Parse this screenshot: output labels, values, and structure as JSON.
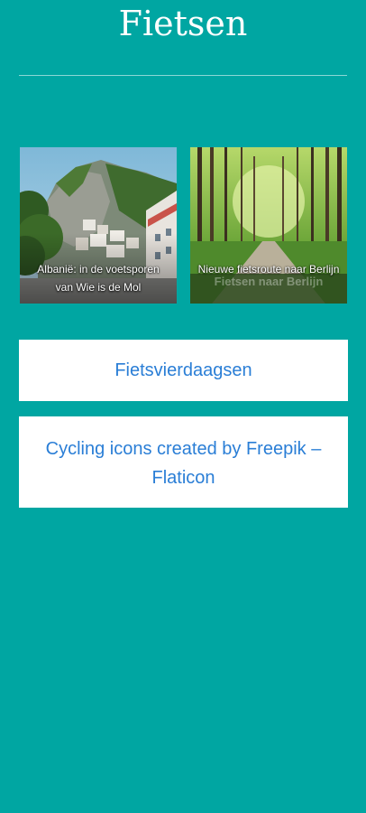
{
  "header": {
    "title": "Fietsen"
  },
  "cards": [
    {
      "caption": "Albanië: in de voetsporen van Wie is de Mol",
      "image": "albania-mountain-town-photo"
    },
    {
      "caption": "Nieuwe fietsroute naar Berlijn",
      "image": "forest-cycling-path-photo",
      "banner_text": "Fietsen naar Berlijn"
    }
  ],
  "links": [
    {
      "label": "Fietsvierdaagsen"
    },
    {
      "label": "Cycling icons created by Freepik – Flaticon"
    }
  ],
  "colors": {
    "background": "#00a6a2",
    "link_text": "#2a7ed6",
    "box": "#ffffff"
  }
}
